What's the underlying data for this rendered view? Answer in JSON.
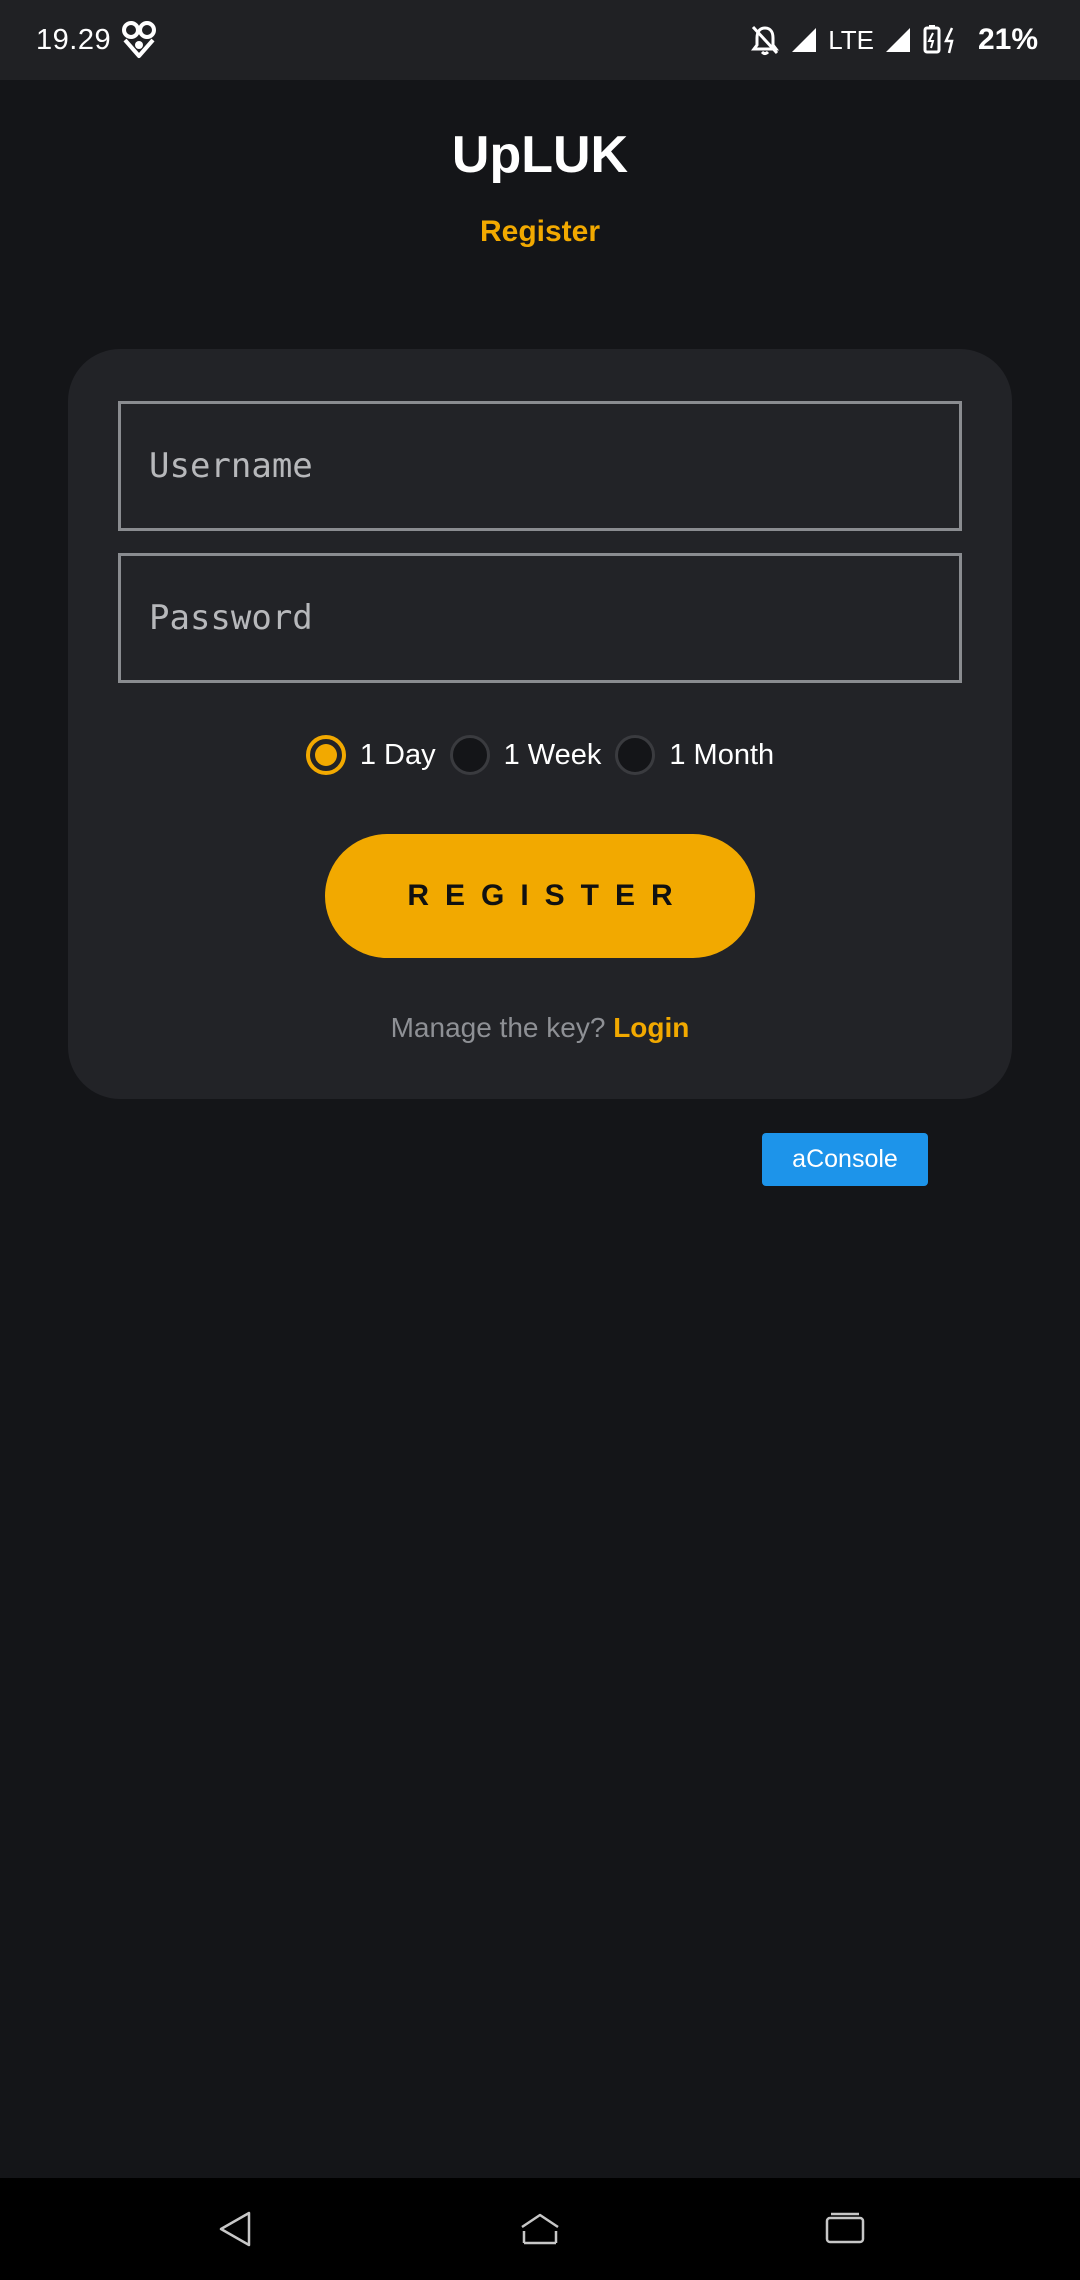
{
  "status_bar": {
    "time": "19.29",
    "network": "LTE",
    "battery": "21%",
    "icons": [
      "heart-link-icon",
      "bell-off-icon",
      "signal-icon",
      "battery-charging-icon"
    ]
  },
  "header": {
    "title": "UpLUK",
    "subtitle": "Register"
  },
  "form": {
    "username_placeholder": "Username",
    "password_placeholder": "Password",
    "username_value": "",
    "password_value": "",
    "durations": [
      {
        "label": "1 Day",
        "selected": true
      },
      {
        "label": "1 Week",
        "selected": false
      },
      {
        "label": "1 Month",
        "selected": false
      }
    ],
    "register_label": "REGISTER",
    "login_prompt": "Manage the key?",
    "login_link": "Login"
  },
  "debug": {
    "aconsole_label": "aConsole"
  },
  "colors": {
    "background": "#141518",
    "card": "#222327",
    "accent": "#f2a900",
    "aconsole": "#1d94ea"
  },
  "nav_bar": {
    "icons": [
      "back-icon",
      "home-icon",
      "recents-icon"
    ]
  }
}
